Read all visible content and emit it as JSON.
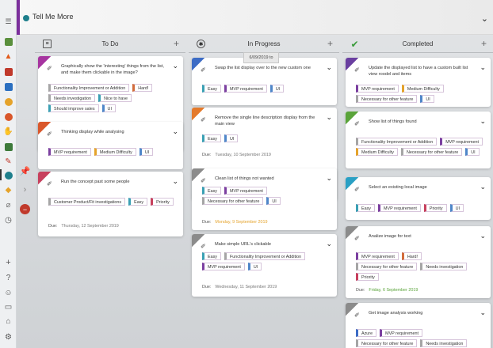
{
  "app": {
    "title": "Tell Me More"
  },
  "columns": [
    {
      "title": "To Do",
      "cards": [
        {
          "title": "Graphically show the 'interesting' things from the list, and make them clickable in the image?",
          "stripe": "#a634a0",
          "tags": [
            {
              "label": "Functionality Improvement or Addition",
              "color": "#a5a5a5"
            },
            {
              "label": "Hard!",
              "color": "#d26c3c"
            },
            {
              "label": "Needs investigation",
              "color": "#a5a5a5"
            },
            {
              "label": "Nice to have",
              "color": "#3aa0b4"
            },
            {
              "label": "Should improve sales",
              "color": "#3aa0b4"
            },
            {
              "label": "UI",
              "color": "#4f86c9"
            }
          ]
        },
        {
          "title": "Thinking display while analysing",
          "stripe": "#d9572b",
          "tags": [
            {
              "label": "MVP requirement",
              "color": "#7b3fa0"
            },
            {
              "label": "Medium Difficulty",
              "color": "#e5a32b"
            },
            {
              "label": "UI",
              "color": "#4f86c9"
            }
          ]
        },
        {
          "title": "Run the concept past some people",
          "stripe": "#c7405d",
          "tags": [
            {
              "label": "Customer Product/Fit investigations",
              "color": "#a5a5a5"
            },
            {
              "label": "Easy",
              "color": "#3aa0b4"
            },
            {
              "label": "Priority",
              "color": "#c7405d"
            }
          ],
          "due_label": "Due:",
          "due": "Thursday, 12 September 2019"
        }
      ]
    },
    {
      "title": "In Progress",
      "cards": [
        {
          "title": "Swap the list display over to the new custom one",
          "stripe": "#3d6cc5",
          "tags": [
            {
              "label": "Easy",
              "color": "#3aa0b4"
            },
            {
              "label": "MVP requirement",
              "color": "#7b3fa0"
            },
            {
              "label": "UI",
              "color": "#4f86c9"
            }
          ]
        },
        {
          "title": "Remove the single line description display from the main view",
          "stripe": "#e47a2b",
          "tags": [
            {
              "label": "Easy",
              "color": "#3aa0b4"
            },
            {
              "label": "UI",
              "color": "#4f86c9"
            }
          ],
          "due_label": "Due:",
          "due": "Tuesday, 10 September 2019"
        },
        {
          "title": "Clean list of things not wanted",
          "stripe": "#8b8b8b",
          "tags": [
            {
              "label": "Easy",
              "color": "#3aa0b4"
            },
            {
              "label": "MVP requirement",
              "color": "#7b3fa0"
            },
            {
              "label": "Necessary for other feature",
              "color": "#a5a5a5"
            },
            {
              "label": "UI",
              "color": "#4f86c9"
            }
          ],
          "due_label": "Due:",
          "due": "Monday, 9 September 2019",
          "due_color": "#e5a32b"
        },
        {
          "title": "Make simple URL's clickable",
          "stripe": "#8b8b8b",
          "tags": [
            {
              "label": "Easy",
              "color": "#3aa0b4"
            },
            {
              "label": "Functionality Improvement or Addition",
              "color": "#a5a5a5"
            },
            {
              "label": "MVP requirement",
              "color": "#7b3fa0"
            },
            {
              "label": "UI",
              "color": "#4f86c9"
            }
          ],
          "due_label": "Due:",
          "due": "Wednesday, 11 September 2019"
        }
      ]
    },
    {
      "title": "Completed",
      "cards": [
        {
          "title": "Update the displayed list to have a custom built list view roodel and items",
          "stripe": "#6a3fa0",
          "tags": [
            {
              "label": "MVP requirement",
              "color": "#7b3fa0"
            },
            {
              "label": "Medium Difficulty",
              "color": "#e5a32b"
            },
            {
              "label": "Necessary for other feature",
              "color": "#a5a5a5"
            },
            {
              "label": "UI",
              "color": "#4f86c9"
            }
          ]
        },
        {
          "title": "Show list of things found",
          "stripe": "#5aa43a",
          "tags": [
            {
              "label": "Functionality Improvement or Addition",
              "color": "#a5a5a5"
            },
            {
              "label": "MVP requirement",
              "color": "#7b3fa0"
            },
            {
              "label": "Medium Difficulty",
              "color": "#e5a32b"
            },
            {
              "label": "Necessary for other feature",
              "color": "#a5a5a5"
            },
            {
              "label": "UI",
              "color": "#4f86c9"
            }
          ]
        },
        {
          "title": "Select an existing local image",
          "stripe": "#2aa0c4",
          "tags": [
            {
              "label": "Easy",
              "color": "#3aa0b4"
            },
            {
              "label": "MVP requirement",
              "color": "#7b3fa0"
            },
            {
              "label": "Priority",
              "color": "#c7405d"
            },
            {
              "label": "UI",
              "color": "#4f86c9"
            }
          ]
        },
        {
          "title": "Analize image for text",
          "stripe": "#8b8b8b",
          "tags": [
            {
              "label": "MVP requirement",
              "color": "#7b3fa0"
            },
            {
              "label": "Hard!",
              "color": "#d26c3c"
            },
            {
              "label": "Necessary for other feature",
              "color": "#a5a5a5"
            },
            {
              "label": "Needs investigation",
              "color": "#a5a5a5"
            },
            {
              "label": "Priority",
              "color": "#c7405d"
            }
          ],
          "due_label": "Due:",
          "due": "Friday, 6 September 2019",
          "due_color": "#5aa43a"
        },
        {
          "title": "Get image analysis working",
          "stripe": "#8b8b8b",
          "tags": [
            {
              "label": "Azure",
              "color": "#3d6cc5"
            },
            {
              "label": "MVP requirement",
              "color": "#7b3fa0"
            },
            {
              "label": "Necessary for other feature",
              "color": "#a5a5a5"
            },
            {
              "label": "Needs investigation",
              "color": "#a5a5a5"
            }
          ]
        }
      ]
    }
  ],
  "tooltip": "6/09/2019 to"
}
